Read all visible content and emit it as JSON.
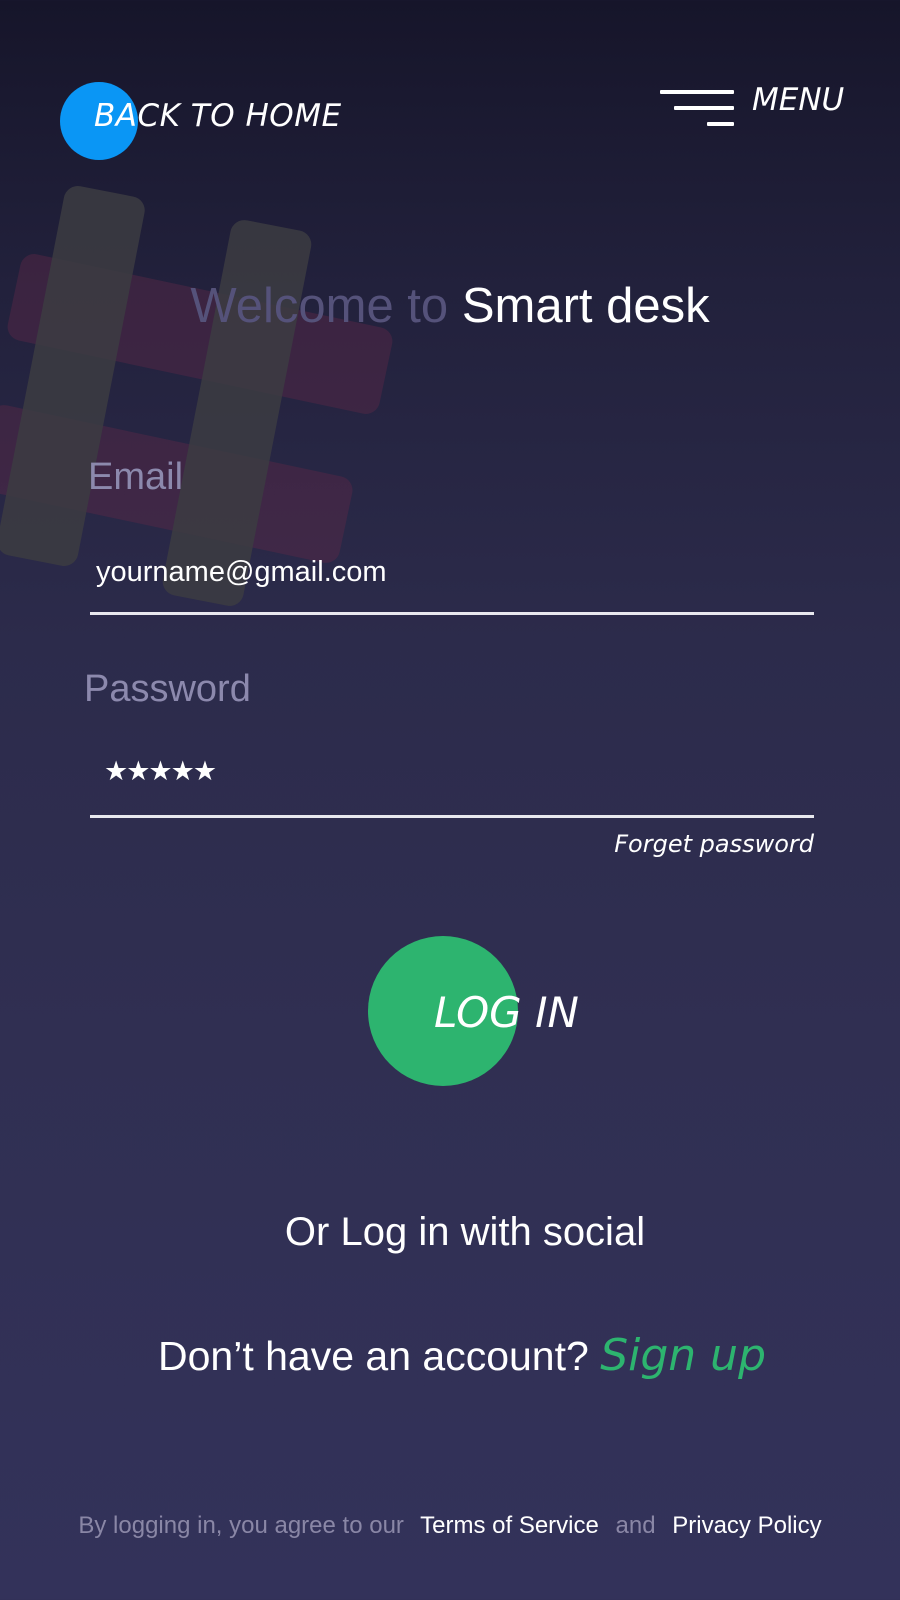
{
  "header": {
    "back_label": "BACK TO HOME",
    "menu_label": "MENU"
  },
  "title": {
    "prefix": "Welcome to",
    "app_name": "Smart desk"
  },
  "form": {
    "email_label": "Email",
    "email_value": "yourname@gmail.com",
    "password_label": "Password",
    "password_mask": "★★★★★",
    "forgot_label": "Forget password"
  },
  "login_button": {
    "label": "LOG IN"
  },
  "social_text": "Or  Log in with social",
  "signup": {
    "prompt": "Don’t have an account?",
    "link": "Sign up"
  },
  "footer": {
    "prefix": "By logging in, you agree to our",
    "terms": "Terms of Service",
    "conjunction": "and",
    "privacy": "Privacy Policy"
  },
  "colors": {
    "accent_blue": "#0a96f5",
    "accent_green": "#2db46f",
    "background_top": "#16152a",
    "background_bottom": "#33325a"
  },
  "icons": {
    "menu": "hamburger-menu-icon",
    "decoration": "hashtag-icon"
  }
}
